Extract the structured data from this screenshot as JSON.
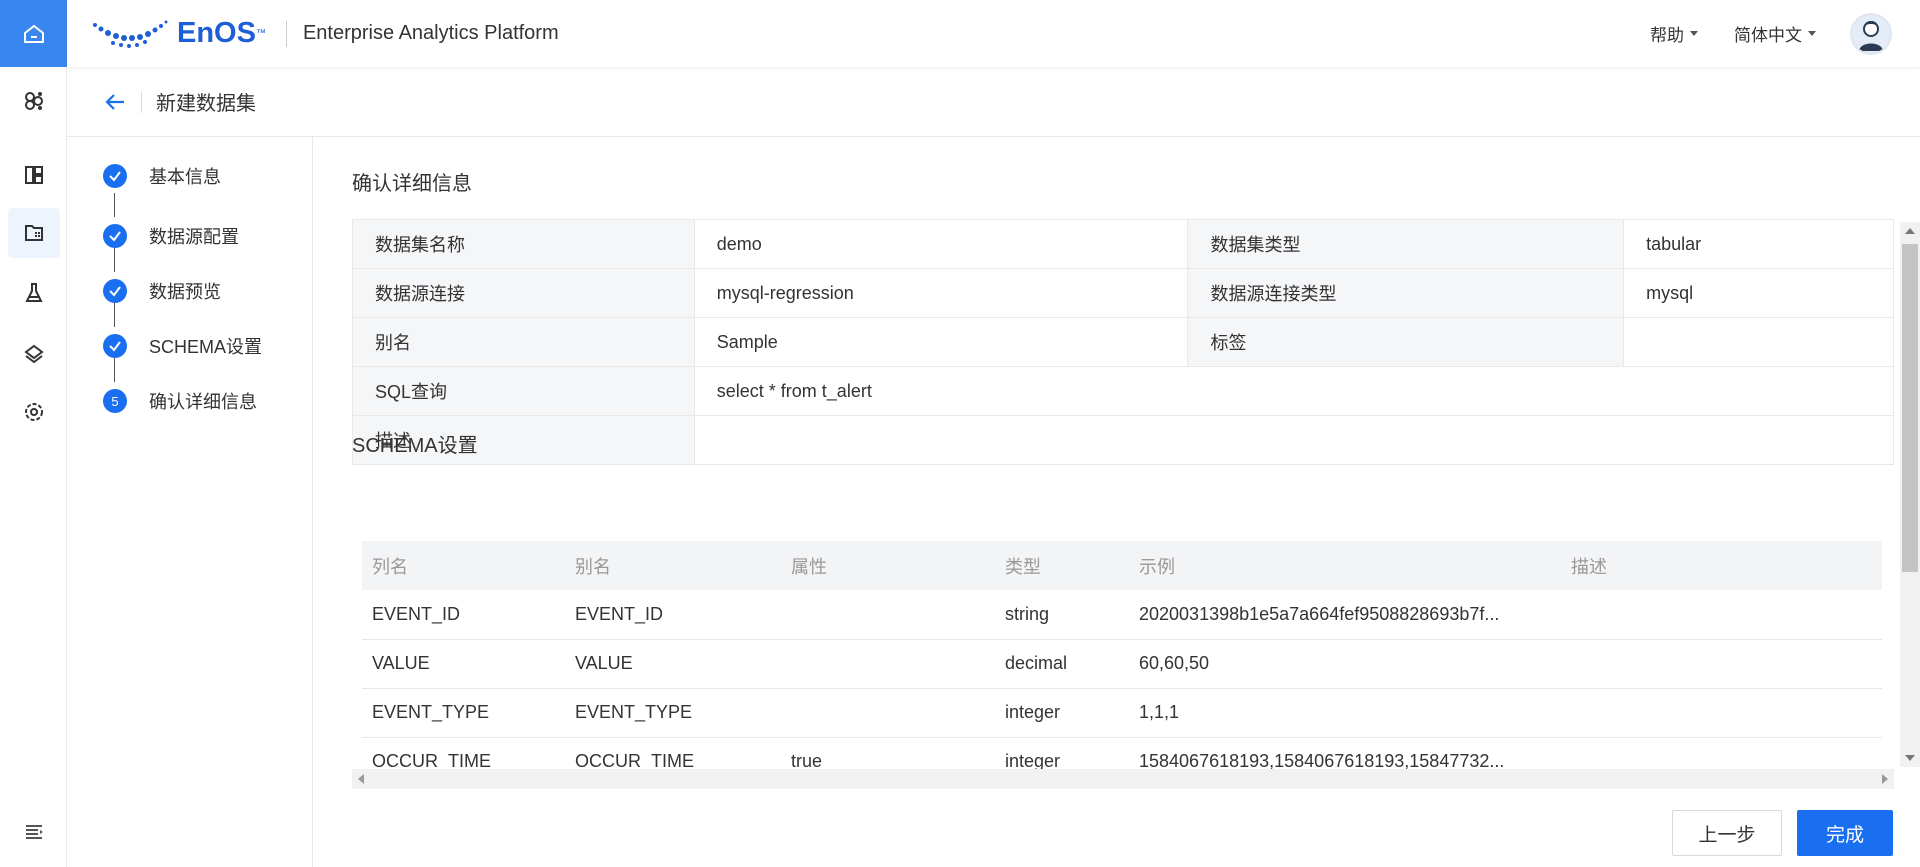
{
  "app": {
    "logo_text": "EnOS",
    "logo_tm": "™",
    "title": "Enterprise Analytics Platform"
  },
  "header": {
    "help": "帮助",
    "language": "简体中文"
  },
  "page": {
    "title": "新建数据集"
  },
  "steps": [
    {
      "label": "基本信息",
      "status": "done"
    },
    {
      "label": "数据源配置",
      "status": "done"
    },
    {
      "label": "数据预览",
      "status": "done"
    },
    {
      "label": "SCHEMA设置",
      "status": "done"
    },
    {
      "label": "确认详细信息",
      "status": "current",
      "number": "5"
    }
  ],
  "details": {
    "title": "确认详细信息",
    "rows": [
      {
        "l1": "数据集名称",
        "v1": "demo",
        "l2": "数据集类型",
        "v2": "tabular"
      },
      {
        "l1": "数据源连接",
        "v1": "mysql-regression",
        "l2": "数据源连接类型",
        "v2": "mysql"
      },
      {
        "l1": "别名",
        "v1": "Sample",
        "l2": "标签",
        "v2": ""
      }
    ],
    "sql_label": "SQL查询",
    "sql_value": "select * from t_alert",
    "desc_label": "描述",
    "desc_value": ""
  },
  "schema": {
    "title": "SCHEMA设置",
    "columns": [
      "列名",
      "别名",
      "属性",
      "类型",
      "示例",
      "描述"
    ],
    "rows": [
      [
        "EVENT_ID",
        "EVENT_ID",
        "",
        "string",
        "2020031398b1e5a7a664fef9508828693b7f...",
        ""
      ],
      [
        "VALUE",
        "VALUE",
        "",
        "decimal",
        "60,60,50",
        ""
      ],
      [
        "EVENT_TYPE",
        "EVENT_TYPE",
        "",
        "integer",
        "1,1,1",
        ""
      ],
      [
        "OCCUR_TIME",
        "OCCUR_TIME",
        "true",
        "integer",
        "1584067618193,1584067618193,15847732...",
        ""
      ]
    ]
  },
  "buttons": {
    "prev": "上一步",
    "done": "完成"
  },
  "colors": {
    "primary": "#1a6ef0",
    "rail_home": "#3a86f0",
    "label_bg": "#f5f6f8"
  }
}
